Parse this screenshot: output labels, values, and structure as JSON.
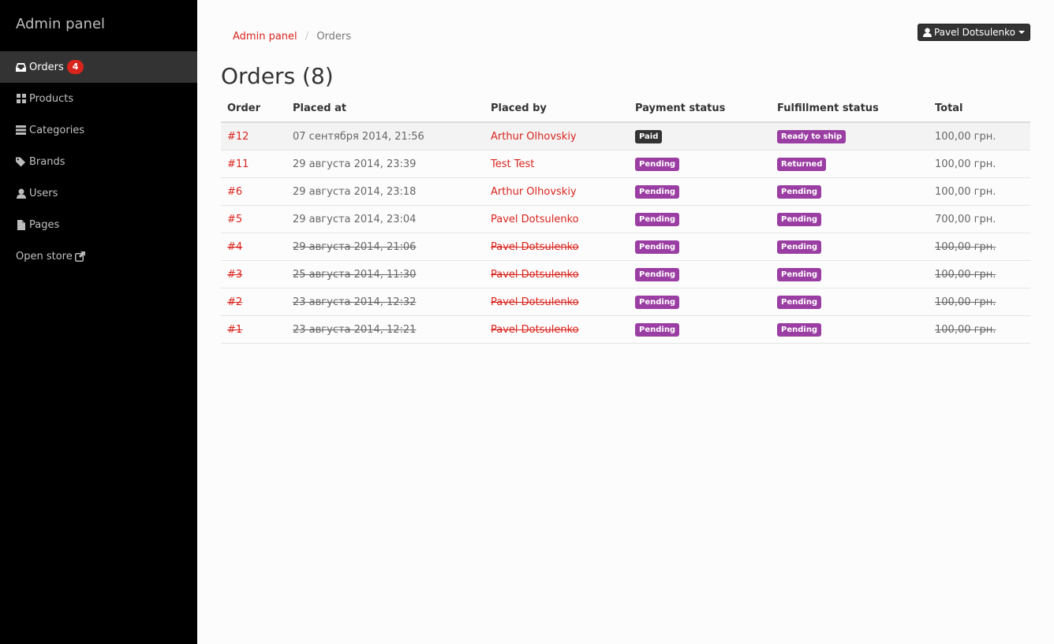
{
  "sidebar": {
    "brand": "Admin panel",
    "items": [
      {
        "label": "Orders",
        "icon": "inbox-icon",
        "badge": "4",
        "active": true
      },
      {
        "label": "Products",
        "icon": "grid-icon"
      },
      {
        "label": "Categories",
        "icon": "list-icon"
      },
      {
        "label": "Brands",
        "icon": "tags-icon"
      },
      {
        "label": "Users",
        "icon": "user-icon"
      },
      {
        "label": "Pages",
        "icon": "file-icon"
      },
      {
        "label": "Open store",
        "icon": "external-link-icon"
      }
    ]
  },
  "breadcrumb": {
    "home": "Admin panel",
    "separator": "/",
    "current": "Orders"
  },
  "user_menu": {
    "name": "Pavel Dotsulenko",
    "icon": "user-icon"
  },
  "page": {
    "title": "Orders (8)"
  },
  "table": {
    "headers": {
      "order": "Order",
      "placed_at": "Placed at",
      "placed_by": "Placed by",
      "payment_status": "Payment status",
      "fulfillment_status": "Fulfillment status",
      "total": "Total"
    },
    "rows": [
      {
        "order": "#12",
        "placed_at": "07 сентября 2014, 21:56",
        "placed_by": "Arthur Olhovskiy",
        "payment": "Paid",
        "fulfillment": "Ready to ship",
        "total": "100,00 грн."
      },
      {
        "order": "#11",
        "placed_at": "29 августа 2014, 23:39",
        "placed_by": "Test Test",
        "payment": "Pending",
        "fulfillment": "Returned",
        "total": "100,00 грн."
      },
      {
        "order": "#6",
        "placed_at": "29 августа 2014, 23:18",
        "placed_by": "Arthur Olhovskiy",
        "payment": "Pending",
        "fulfillment": "Pending",
        "total": "100,00 грн."
      },
      {
        "order": "#5",
        "placed_at": "29 августа 2014, 23:04",
        "placed_by": "Pavel Dotsulenko",
        "payment": "Pending",
        "fulfillment": "Pending",
        "total": "700,00 грн."
      },
      {
        "order": "#4",
        "placed_at": "29 августа 2014, 21:06",
        "placed_by": "Pavel Dotsulenko",
        "payment": "Pending",
        "fulfillment": "Pending",
        "total": "100,00 грн."
      },
      {
        "order": "#3",
        "placed_at": "25 августа 2014, 11:30",
        "placed_by": "Pavel Dotsulenko",
        "payment": "Pending",
        "fulfillment": "Pending",
        "total": "100,00 грн."
      },
      {
        "order": "#2",
        "placed_at": "23 августа 2014, 12:32",
        "placed_by": "Pavel Dotsulenko",
        "payment": "Pending",
        "fulfillment": "Pending",
        "total": "100,00 грн."
      },
      {
        "order": "#1",
        "placed_at": "23 августа 2014, 12:21",
        "placed_by": "Pavel Dotsulenko",
        "payment": "Pending",
        "fulfillment": "Pending",
        "total": "100,00 грн."
      }
    ]
  },
  "colors": {
    "accent": "#d9231d",
    "sidebar_bg": "#000000",
    "active_item_bg": "#333333",
    "label_dark": "#333333",
    "label_purple": "#9b3ea3"
  }
}
